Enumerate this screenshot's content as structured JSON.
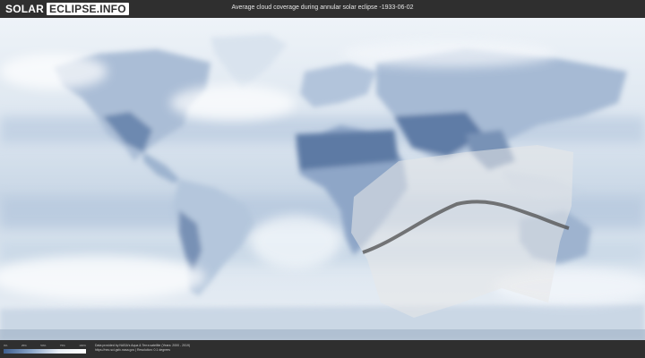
{
  "header": {
    "logo_left": "SOLAR",
    "logo_right": "ECLIPSE.INFO",
    "title": "Average cloud coverage during annular solar eclipse -1933-06-02"
  },
  "legend": {
    "ticks": [
      "0%",
      "25%",
      "50%",
      "75%",
      "100%"
    ],
    "gradient_colors": [
      "#3f5f8f",
      "#8aa6c9",
      "#e8eef6",
      "#ffffff"
    ]
  },
  "footer": {
    "credit_line1": "Data provided by NASA's Aqua & Terra satellite (Years: 2000 - 2019)",
    "credit_line2": "https://neo.sci.gsfc.nasa.gov  |  Resolution: 0.1 degrees"
  },
  "colors": {
    "background": "#2f2f2f",
    "clear_sky": "#4f6d97",
    "cloudy": "#ffffff",
    "eclipse_band": "#e8e8e8",
    "eclipse_path": "#555555"
  },
  "icons": {
    "logo": "solar-eclipse-logo"
  }
}
